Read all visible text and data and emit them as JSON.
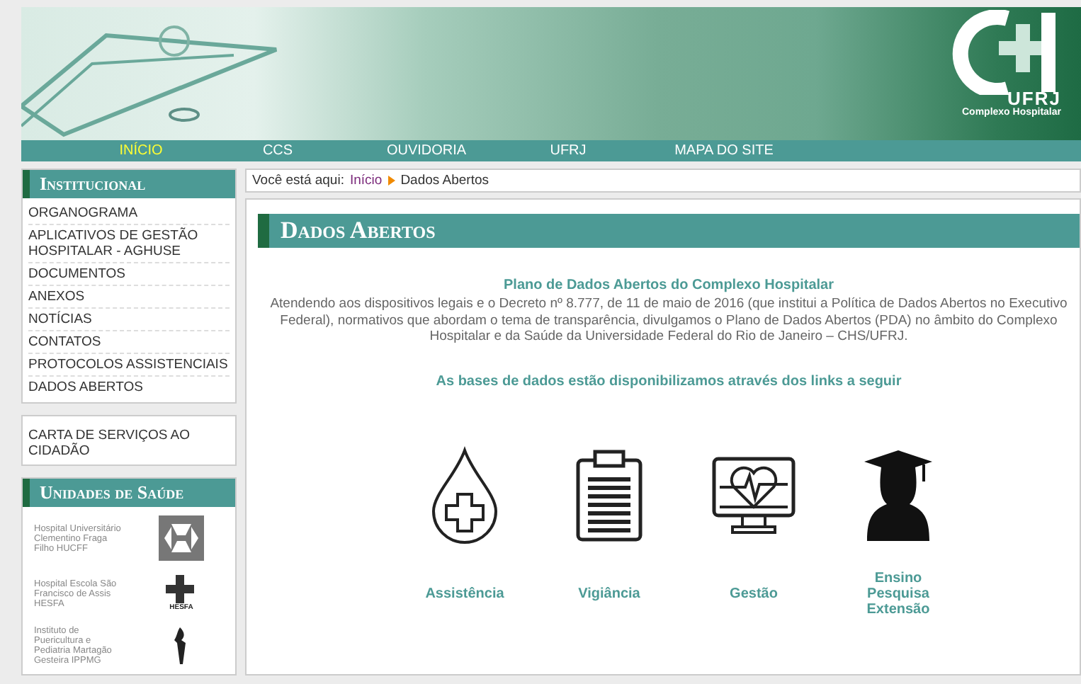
{
  "header": {
    "logo_text": "UFRJ",
    "logo_subtitle": "Complexo Hospitalar"
  },
  "nav": [
    {
      "label": "INÍCIO",
      "selected": true
    },
    {
      "label": "CCS",
      "selected": false
    },
    {
      "label": "OUVIDORIA",
      "selected": false
    },
    {
      "label": "UFRJ",
      "selected": false
    },
    {
      "label": "MAPA DO SITE",
      "selected": false
    }
  ],
  "sidebar": {
    "institucional": {
      "title": "Institucional",
      "items": [
        "ORGANOGRAMA",
        "APLICATIVOS DE GESTÃO HOSPITALAR - AGHUSE",
        "DOCUMENTOS",
        "ANEXOS",
        "NOTÍCIAS",
        "CONTATOS",
        "PROTOCOLOS ASSISTENCIAIS",
        "DADOS ABERTOS"
      ]
    },
    "carta": "CARTA DE SERVIÇOS AO CIDADÃO",
    "unidades": {
      "title": "Unidades de Saúde",
      "items": [
        {
          "name": "Hospital Universitário Clementino Fraga Filho HUCFF",
          "kind": "hucff"
        },
        {
          "name": "Hospital Escola São Francisco de Assis HESFA",
          "kind": "hesfa",
          "logo_text": "HESFA"
        },
        {
          "name": "Instituto de Puericultura e Pediatria Martagão Gesteira IPPMG",
          "kind": "ippmg"
        }
      ]
    }
  },
  "breadcrumb": {
    "prefix": "Você está aqui:",
    "items": [
      "Início",
      "Dados Abertos"
    ]
  },
  "content": {
    "title": "Dados Abertos",
    "subtitle": "Plano de Dados Abertos do Complexo Hospitalar",
    "paragraph": "Atendendo aos dispositivos legais e o Decreto nº 8.777, de 11 de maio de 2016 (que institui a Política de Dados Abertos no Executivo Federal), normativos que abordam o tema de transparência, divulgamos o Plano de Dados Abertos (PDA) no âmbito do Complexo Hospitalar e da Saúde da Universidade Federal do Rio de Janeiro – CHS/UFRJ.",
    "links_intro": "As bases de dados estão disponibilizamos através dos links a seguir",
    "links": [
      {
        "kind": "drop",
        "label": "Assistência"
      },
      {
        "kind": "clipboard",
        "label": "Vigiância"
      },
      {
        "kind": "monitor",
        "label": "Gestão"
      },
      {
        "kind": "graduate",
        "label": "Ensino\nPesquisa\nExtensão"
      }
    ]
  }
}
